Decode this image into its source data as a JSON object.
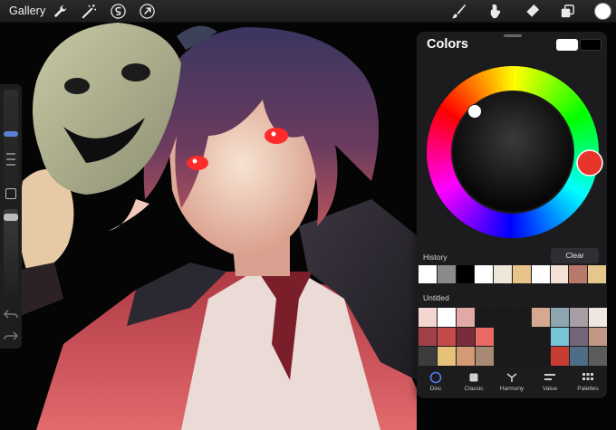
{
  "topbar": {
    "gallery_label": "Gallery",
    "left_tools": [
      {
        "name": "wrench-icon"
      },
      {
        "name": "magic-wand-icon"
      },
      {
        "name": "selection-icon"
      },
      {
        "name": "transform-arrow-icon"
      }
    ],
    "right_tools": [
      {
        "name": "brush-icon"
      },
      {
        "name": "smudge-icon"
      },
      {
        "name": "eraser-icon"
      },
      {
        "name": "layers-icon"
      }
    ],
    "active_color": "#ffffff"
  },
  "sidebar": {
    "brush_size_value": 0.55,
    "opacity_value": 0.95,
    "icons": [
      "undo-icon",
      "redo-icon",
      "square-modify-icon"
    ]
  },
  "colors_panel": {
    "title": "Colors",
    "current_color": "#ffffff",
    "previous_color": "#000000",
    "hue_selected": "#e8342a",
    "history_label": "History",
    "clear_label": "Clear",
    "history": [
      "#ffffff",
      "#8a8a8a",
      "#000000",
      "#ffffff",
      "#efe6da",
      "#e8c38a",
      "#ffffff",
      "#f3e1d6",
      "#b77a6a",
      "#e5c78e"
    ],
    "palette_title": "Untitled",
    "palette": [
      "#f3d6d0",
      "#ffffff",
      "#e0a9a6",
      "#1a1a1a",
      "#1a1a1a",
      "#1a1a1a",
      "#d4a98f",
      "#8da6b0",
      "#a99ea6",
      "#efe6e2",
      "#a2404a",
      "#c44a4b",
      "#7a2d38",
      "#e86a62",
      "#1a1a1a",
      "#1a1a1a",
      "#1a1a1a",
      "#79c3d8",
      "#756579",
      "#c09782",
      "#3c3c3c",
      "#e6c178",
      "#d39a76",
      "#a88a74",
      "#1a1a1a",
      "#1a1a1a",
      "#1a1a1a",
      "#c83d33",
      "#4d6c86",
      "#5c5c5c"
    ],
    "tabs": [
      {
        "label": "Disc",
        "icon": "disc-icon"
      },
      {
        "label": "Classic",
        "icon": "classic-square-icon"
      },
      {
        "label": "Harmony",
        "icon": "harmony-icon"
      },
      {
        "label": "Value",
        "icon": "value-sliders-icon"
      },
      {
        "label": "Palettes",
        "icon": "palettes-grid-icon"
      }
    ]
  }
}
